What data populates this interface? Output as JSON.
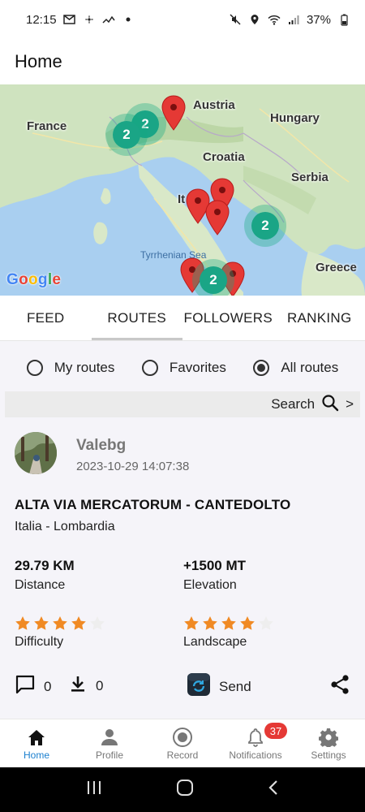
{
  "status_bar": {
    "time": "12:15",
    "battery": "37%"
  },
  "header": {
    "title": "Home"
  },
  "map": {
    "labels": {
      "france": "France",
      "austria": "Austria",
      "hungary": "Hungary",
      "croatia": "Croatia",
      "serbia": "Serbia",
      "italy": "It",
      "tyrrhenian": "Tyrrhenian Sea",
      "greece": "Greece"
    },
    "clusters": [
      {
        "count": "2"
      },
      {
        "count": "2"
      },
      {
        "count": "2"
      },
      {
        "count": "2"
      }
    ],
    "logo": "Google",
    "pin_color": "#e53935",
    "cluster_color": "#1aa586"
  },
  "tabs": [
    {
      "label": "FEED"
    },
    {
      "label": "ROUTES"
    },
    {
      "label": "FOLLOWERS"
    },
    {
      "label": "RANKING"
    }
  ],
  "filters": {
    "options": [
      {
        "label": "My routes",
        "checked": false
      },
      {
        "label": "Favorites",
        "checked": false
      },
      {
        "label": "All routes",
        "checked": true
      }
    ]
  },
  "search": {
    "label": "Search",
    "chevron": ">"
  },
  "route": {
    "username": "Valebg",
    "timestamp": "2023-10-29 14:07:38",
    "title": "ALTA VIA MERCATORUM - CANTEDOLTO",
    "region": "Italia - Lombardia",
    "distance_value": "29.79 KM",
    "distance_label": "Distance",
    "elevation_value": "+1500 MT",
    "elevation_label": "Elevation",
    "difficulty_label": "Difficulty",
    "difficulty_rating": 4,
    "landscape_label": "Landscape",
    "landscape_rating": 4,
    "max_rating": 5,
    "star_color": "#f08a24",
    "comments_count": "0",
    "downloads_count": "0",
    "send_label": "Send"
  },
  "bottom_nav": [
    {
      "label": "Home",
      "icon": "home-icon",
      "active": true
    },
    {
      "label": "Profile",
      "icon": "person-icon",
      "active": false
    },
    {
      "label": "Record",
      "icon": "record-icon",
      "active": false
    },
    {
      "label": "Notifications",
      "icon": "bell-icon",
      "active": false,
      "badge": "37"
    },
    {
      "label": "Settings",
      "icon": "gear-icon",
      "active": false
    }
  ],
  "accent_color": "#1a7fcf"
}
